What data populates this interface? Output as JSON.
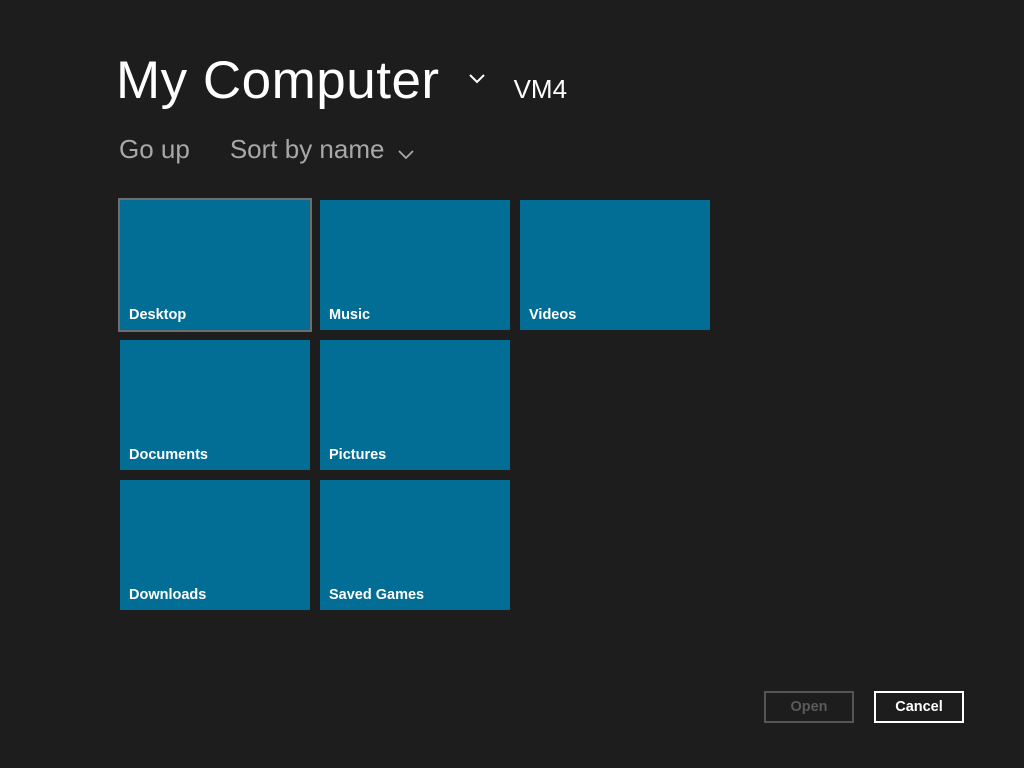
{
  "header": {
    "title": "My Computer",
    "machine": "VM4"
  },
  "commands": {
    "go_up": "Go up",
    "sort": "Sort by name"
  },
  "tiles": [
    {
      "label": "Desktop"
    },
    {
      "label": "Music"
    },
    {
      "label": "Videos"
    },
    {
      "label": "Documents"
    },
    {
      "label": "Pictures"
    },
    {
      "label": "Downloads"
    },
    {
      "label": "Saved Games"
    }
  ],
  "buttons": {
    "open": "Open",
    "cancel": "Cancel"
  },
  "colors": {
    "background": "#1d1d1d",
    "tile": "#036e95"
  }
}
